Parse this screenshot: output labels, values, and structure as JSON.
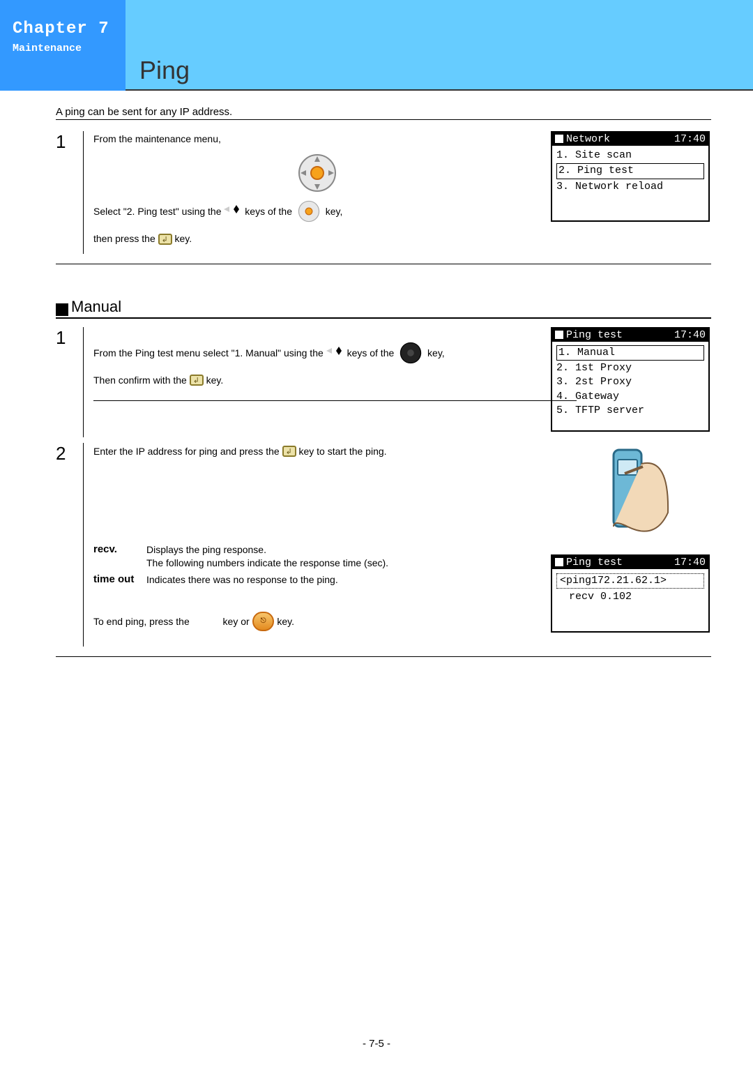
{
  "chapter": {
    "title": "Chapter 7",
    "subtitle": "Maintenance"
  },
  "page_title": "Ping",
  "intro": "A ping can be sent for any IP address.",
  "section_manual": "Manual",
  "steps_top": {
    "num": "1",
    "line1": "From the maintenance menu,",
    "line2_a": "Select \"2. Ping test\"  using the ",
    "line2_b": " keys of the ",
    "line2_c": " key,",
    "line3_a": "then press the ",
    "line3_b": " key."
  },
  "lcd_network": {
    "title": "Network",
    "time": "17:40",
    "items": [
      "1. Site scan",
      "2. Ping test",
      "3. Network reload"
    ]
  },
  "manual_step1": {
    "num": "1",
    "line1_a": "From the Ping test menu select \"1. Manual\" using the ",
    "line1_b": " keys of the ",
    "line1_c": " key,",
    "line2_a": "Then confirm with the ",
    "line2_b": " key."
  },
  "lcd_pingtest_menu": {
    "title": "Ping test",
    "time": "17:40",
    "items": [
      "1. Manual",
      "2. 1st Proxy",
      "3. 2st Proxy",
      "4. Gateway",
      "5. TFTP server"
    ]
  },
  "manual_step2": {
    "num": "2",
    "line1_a": "Enter the IP address for ping and press the ",
    "line1_b": " key to start the ping.",
    "recv_term": "recv.",
    "recv_desc1": "Displays the ping response.",
    "recv_desc2": "The following numbers indicate the response time (sec).",
    "timeout_term": "time out",
    "timeout_desc": "Indicates there was no response to the ping.",
    "end_a": "To end ping, press the ",
    "end_b": " key or ",
    "end_c": " key."
  },
  "lcd_ping_result": {
    "title": "Ping test",
    "time": "17:40",
    "line1": "<ping172.21.62.1>",
    "line2": "recv  0.102"
  },
  "footer": "- 7-5 -"
}
